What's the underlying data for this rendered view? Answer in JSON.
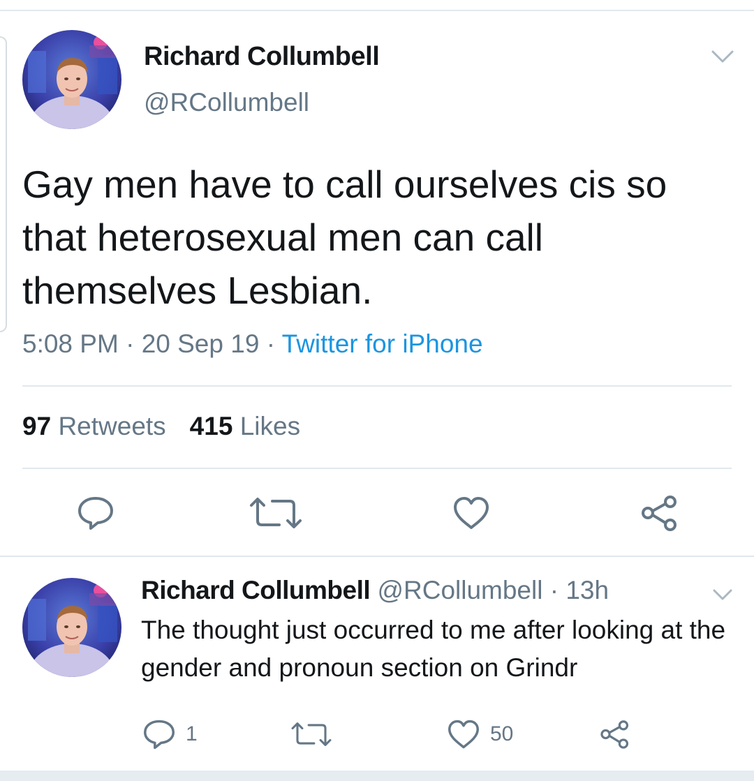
{
  "main_tweet": {
    "display_name": "Richard Collumbell",
    "handle": "@RCollumbell",
    "text": "Gay men have to call ourselves cis so that heterosexual men can call themselves Lesbian.",
    "time": "5:08 PM",
    "date": "20 Sep 19",
    "separator": "·",
    "source": "Twitter for iPhone",
    "retweets_count": "97",
    "retweets_label": "Retweets",
    "likes_count": "415",
    "likes_label": "Likes",
    "icons": [
      "reply-icon",
      "retweet-icon",
      "like-icon",
      "share-icon",
      "chevron-down-icon"
    ]
  },
  "reply_tweet": {
    "display_name": "Richard Collumbell",
    "handle": "@RCollumbell",
    "separator": "·",
    "age": "13h",
    "text": "The thought just occurred to me after looking at the gender and pronoun section on Grindr",
    "reply_count": "1",
    "like_count": "50",
    "icons": [
      "reply-icon",
      "retweet-icon",
      "like-icon",
      "share-icon",
      "chevron-down-icon"
    ]
  },
  "colors": {
    "text_primary": "#14171a",
    "text_secondary": "#657786",
    "link": "#1b95e0",
    "divider": "#e1e8ed",
    "icon": "#657786"
  }
}
